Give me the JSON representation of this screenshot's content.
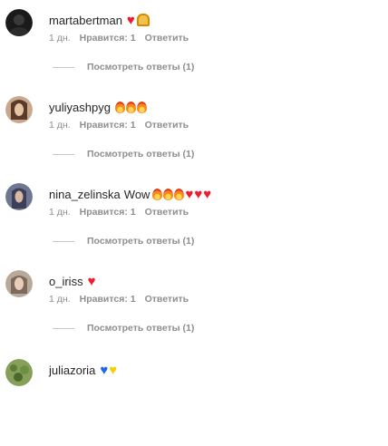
{
  "comments": [
    {
      "username": "martabertman",
      "text": "",
      "emojis": [
        "heart-red",
        "ghost-yellow"
      ],
      "time": "1 дн.",
      "likes": "Нравится: 1",
      "reply": "Ответить",
      "view_replies": "Посмотреть ответы (1)",
      "avatar_color": "#1a1a1a"
    },
    {
      "username": "yuliyashpyg",
      "text": "",
      "emojis": [
        "fire",
        "fire",
        "fire"
      ],
      "time": "1 дн.",
      "likes": "Нравится: 1",
      "reply": "Ответить",
      "view_replies": "Посмотреть ответы (1)",
      "avatar_color": "#5a3b2a"
    },
    {
      "username": "nina_zelinska",
      "text": "Wow",
      "emojis": [
        "fire",
        "fire",
        "fire",
        "heart-red",
        "heart-red",
        "heart-red"
      ],
      "time": "1 дн.",
      "likes": "Нравится: 1",
      "reply": "Ответить",
      "view_replies": "Посмотреть ответы (1)",
      "avatar_color": "#4a4f70"
    },
    {
      "username": "o_iriss",
      "text": "",
      "emojis": [
        "heart-red"
      ],
      "time": "1 дн.",
      "likes": "Нравится: 1",
      "reply": "Ответить",
      "view_replies": "Посмотреть ответы (1)",
      "avatar_color": "#b9a99a"
    },
    {
      "username": "juliazoria",
      "text": "",
      "emojis": [
        "heart-blue",
        "heart-yellow"
      ],
      "avatar_color": "#5f7b3a"
    }
  ]
}
